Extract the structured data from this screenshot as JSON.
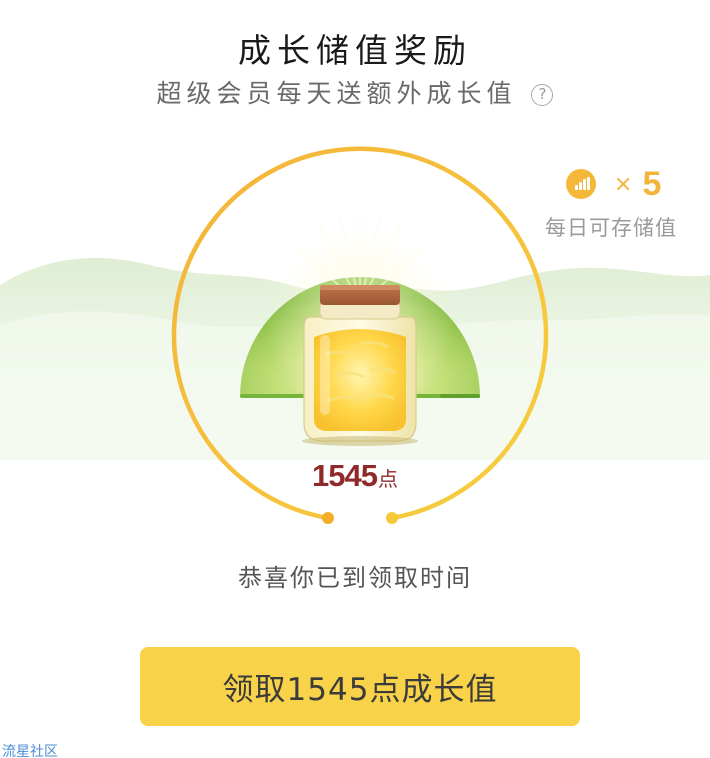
{
  "header": {
    "title": "成长储值奖励",
    "subtitle": "超级会员每天送额外成长值",
    "help_icon": "?"
  },
  "jar": {
    "points_value": "1545",
    "points_unit": "点"
  },
  "daily_badge": {
    "icon": "coin-signal-icon",
    "times_symbol": "×",
    "multiplier": "5",
    "label": "每日可存储值"
  },
  "status_text": "恭喜你已到领取时间",
  "claim_button": {
    "label": "领取1545点成长值"
  },
  "watermark": "流星社区",
  "colors": {
    "ring": "#f3ad2a",
    "button": "#f8d248",
    "points": "#8e2a2a",
    "hill": "#e3f1d8",
    "sun_green": "#8cc63f"
  }
}
